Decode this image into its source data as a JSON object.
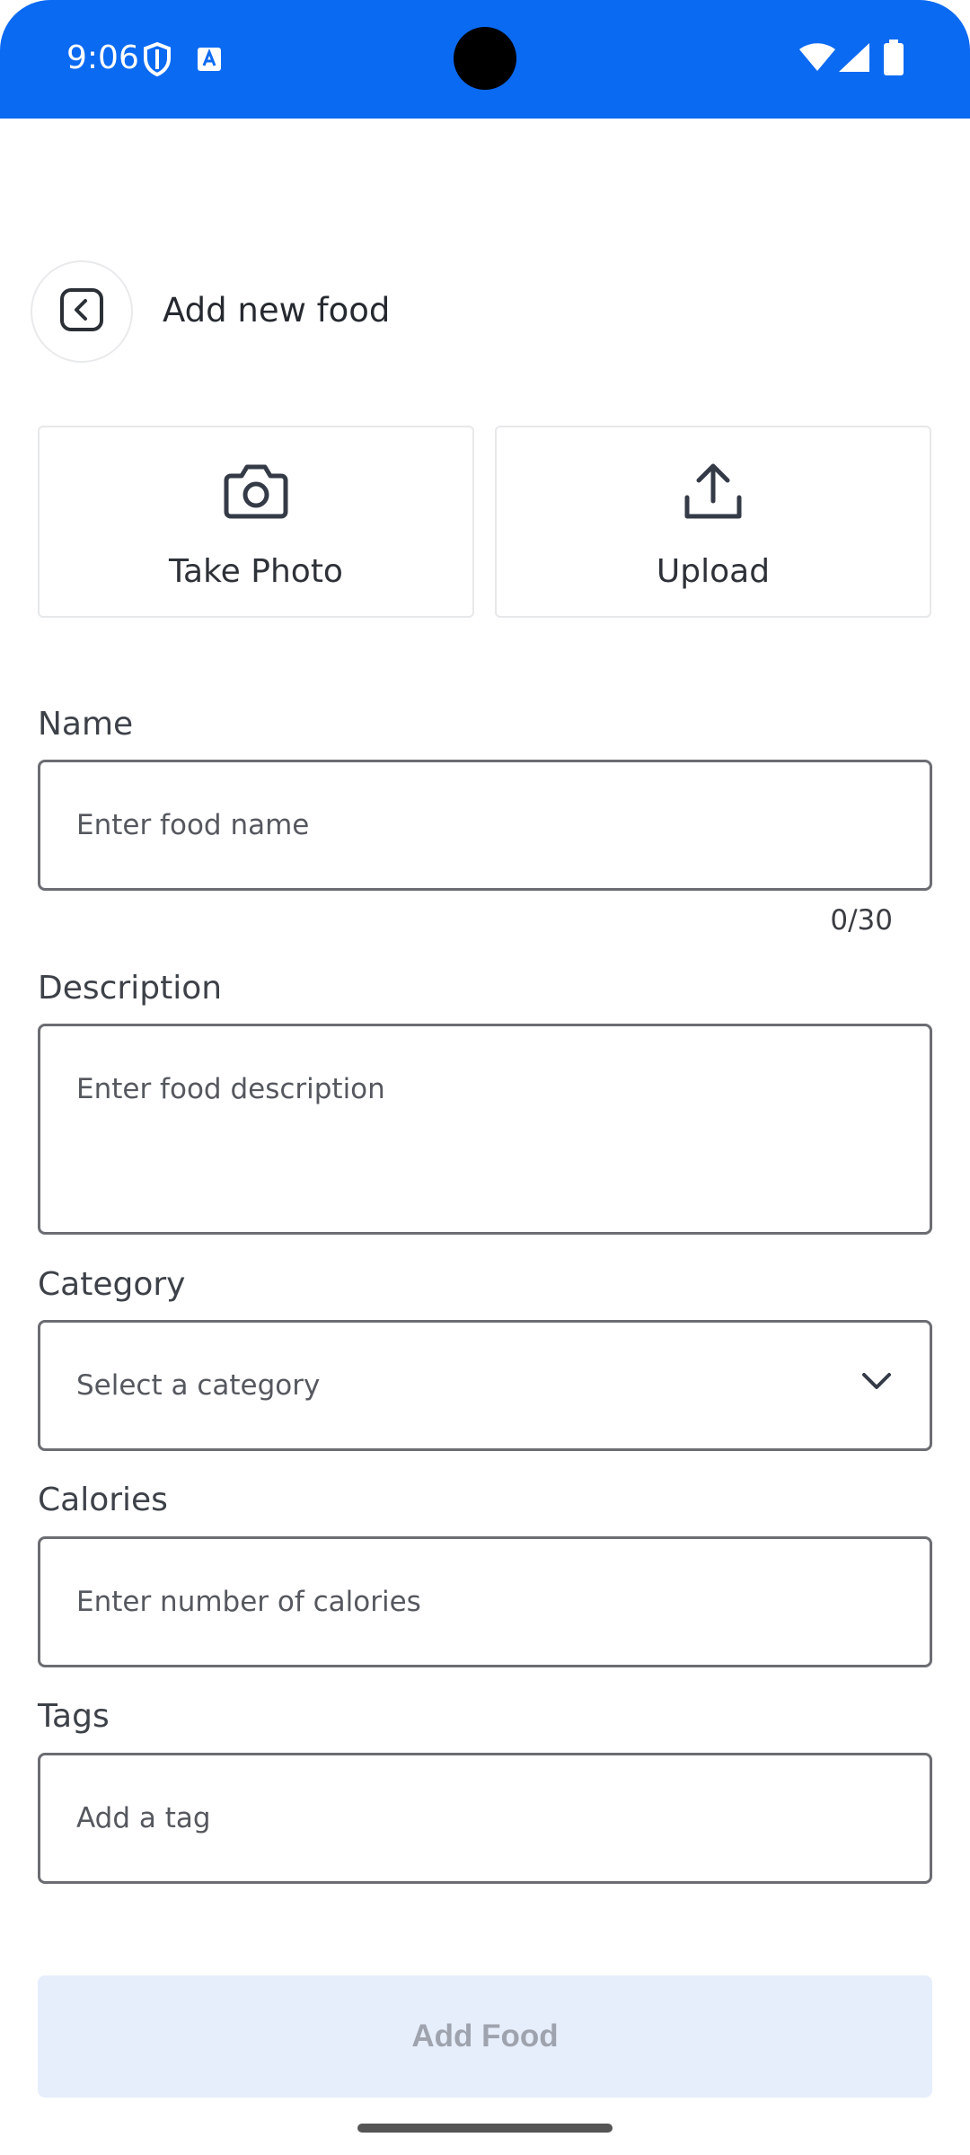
{
  "status_bar": {
    "time": "9:06",
    "icons": [
      "shield-icon",
      "translate-icon",
      "wifi-icon",
      "signal-icon",
      "battery-icon"
    ]
  },
  "header": {
    "back_icon": "chevron-left-icon",
    "title": "Add new food"
  },
  "media": {
    "take_photo_label": "Take Photo",
    "take_photo_icon": "camera-icon",
    "upload_label": "Upload",
    "upload_icon": "upload-icon"
  },
  "form": {
    "name": {
      "label": "Name",
      "placeholder": "Enter food name",
      "value": "",
      "counter": "0/30"
    },
    "description": {
      "label": "Description",
      "placeholder": "Enter food description",
      "value": ""
    },
    "category": {
      "label": "Category",
      "placeholder": "Select a category",
      "value": ""
    },
    "calories": {
      "label": "Calories",
      "placeholder": "Enter number of calories",
      "value": ""
    },
    "tags": {
      "label": "Tags",
      "placeholder": "Add a tag",
      "value": ""
    }
  },
  "actions": {
    "submit_label": "Add Food"
  },
  "colors": {
    "status_bar": "#0b6af2",
    "button_disabled_bg": "#e6eefc",
    "button_disabled_text": "#9ea3ad",
    "input_border": "#6b6d72"
  }
}
